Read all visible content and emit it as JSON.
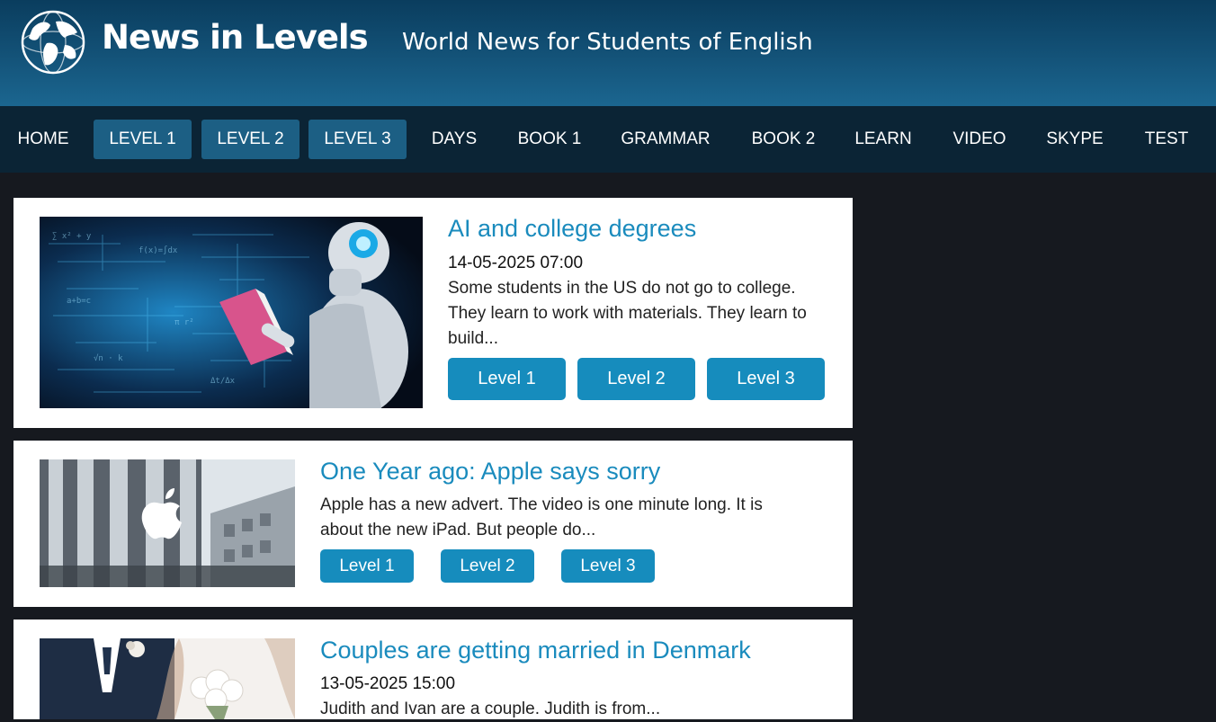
{
  "header": {
    "site_title": "News in Levels",
    "tagline": "World News for Students of English"
  },
  "nav": {
    "items": [
      {
        "label": "HOME",
        "active": false
      },
      {
        "label": "LEVEL 1",
        "active": true
      },
      {
        "label": "LEVEL 2",
        "active": true
      },
      {
        "label": "LEVEL 3",
        "active": true
      },
      {
        "label": "DAYS",
        "active": false
      },
      {
        "label": "BOOK 1",
        "active": false
      },
      {
        "label": "GRAMMAR",
        "active": false
      },
      {
        "label": "BOOK 2",
        "active": false
      },
      {
        "label": "LEARN",
        "active": false
      },
      {
        "label": "VIDEO",
        "active": false
      },
      {
        "label": "SKYPE",
        "active": false
      },
      {
        "label": "TEST",
        "active": false
      }
    ]
  },
  "articles": [
    {
      "title": "AI and college degrees",
      "date": "14-05-2025 07:00",
      "excerpt": "Some students in the US do not go to college. They learn to work with materials. They learn to build...",
      "buttons": [
        "Level 1",
        "Level 2",
        "Level 3"
      ]
    },
    {
      "title": "One Year ago: Apple says sorry",
      "excerpt": "Apple has a new advert. The video is one minute long. It is about the new iPad. But people do...",
      "buttons": [
        "Level 1",
        "Level 2",
        "Level 3"
      ]
    },
    {
      "title": "Couples are getting married in Denmark",
      "date": "13-05-2025 15:00",
      "excerpt": "Judith and Ivan are a couple. Judith is from..."
    }
  ],
  "colors": {
    "header": "#124f74",
    "nav": "#0b2435",
    "nav_active": "#1c5f84",
    "link": "#1a8bbd",
    "button": "#168cbd",
    "page_bg": "#16191f"
  },
  "icons": {
    "logo": "globe-icon"
  }
}
